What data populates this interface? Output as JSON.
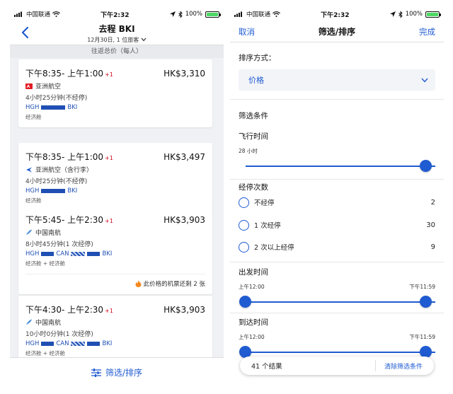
{
  "left": {
    "status": {
      "carrier": "中国联通",
      "time": "下午2:32",
      "battery": "100%"
    },
    "nav": {
      "title": "去程 BKI",
      "subtitle": "12月30日, 1 位旅客"
    },
    "section_header": "往返总价（每人）",
    "flights": [
      {
        "time": "下午8:35- 上午1:00",
        "plus": "+1",
        "price": "HK$3,310",
        "airline": "亚洲航空",
        "airline_icon": "airasia-logo-icon",
        "duration": "4小时25分钟(不经停)",
        "from": "HGH",
        "via": "",
        "to": "BKI",
        "cabin": "经济舱",
        "notice": ""
      },
      {
        "time": "下午8:35- 上午1:00",
        "plus": "+1",
        "price": "HK$3,497",
        "airline": "亚洲航空（含行李）",
        "airline_icon": "plane-icon",
        "duration": "4小时25分钟(不经停)",
        "from": "HGH",
        "via": "",
        "to": "BKI",
        "cabin": "经济舱",
        "notice": ""
      },
      {
        "time": "下午5:45- 上午2:30",
        "plus": "+1",
        "price": "HK$3,903",
        "airline": "中国南航",
        "airline_icon": "china-southern-logo-icon",
        "duration": "8小时45分钟(1 次经停)",
        "from": "HGH",
        "via": "CAN",
        "to": "BKI",
        "cabin": "经济舱 + 经济舱",
        "notice": "此价格的机票还剩 2 张"
      },
      {
        "time": "下午4:30- 上午2:30",
        "plus": "+1",
        "price": "HK$3,903",
        "airline": "中国南航",
        "airline_icon": "china-southern-logo-icon",
        "duration": "10小时0分钟(1 次经停)",
        "from": "HGH",
        "via": "CAN",
        "to": "BKI",
        "cabin": "经济舱 + 经济舱",
        "notice": ""
      }
    ],
    "bottom_label": "筛选/排序"
  },
  "right": {
    "status": {
      "carrier": "中国联通",
      "time": "下午2:32",
      "battery": "100%"
    },
    "nav": {
      "cancel": "取消",
      "title": "筛选/排序",
      "done": "完成"
    },
    "sort_label": "排序方式：",
    "sort_value": "价格",
    "filters_title": "筛选条件",
    "flight_time": {
      "label": "飞行时间",
      "value": "28 小时"
    },
    "stops": {
      "label": "经停次数",
      "options": [
        {
          "label": "不经停",
          "count": "2"
        },
        {
          "label": "1 次经停",
          "count": "30"
        },
        {
          "label": "2 次以上经停",
          "count": "9"
        }
      ]
    },
    "departure": {
      "label": "出发时间",
      "min": "上午12:00",
      "max": "下午11:59"
    },
    "arrival": {
      "label": "到达时间",
      "min": "上午12:00",
      "max": "下午11:59"
    },
    "results": "41 个结果",
    "clear": "清除筛选条件"
  },
  "colors": {
    "accent": "#1f5bd1",
    "route": "#1f4fb4",
    "plus_day": "#d0021b",
    "battery": "#4cd964"
  }
}
